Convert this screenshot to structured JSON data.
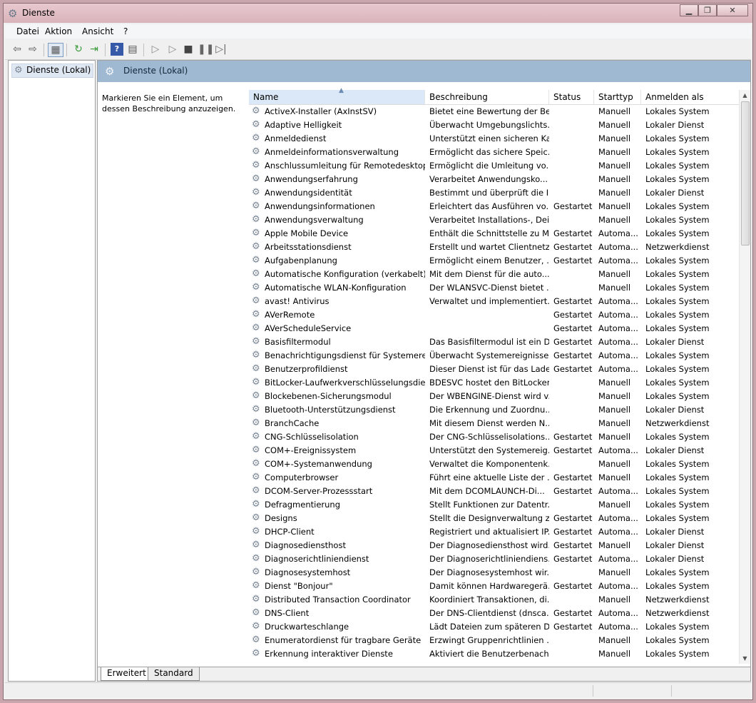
{
  "window": {
    "title": "Dienste",
    "app_icon": "gear-icon"
  },
  "menu": [
    "Datei",
    "Aktion",
    "Ansicht",
    "?"
  ],
  "toolbar_icons": [
    "back-arrow-icon",
    "forward-arrow-icon",
    "show-hide-console-tree-icon",
    "refresh-icon",
    "export-list-icon",
    "help-icon",
    "properties-icon",
    "start-service-icon",
    "start-service-alt-icon",
    "stop-service-icon",
    "pause-service-icon",
    "restart-service-icon"
  ],
  "tree": {
    "item": "Dienste (Lokal)"
  },
  "header": {
    "title": "Dienste (Lokal)"
  },
  "description_panel": {
    "text": "Markieren Sie ein Element, um dessen Beschreibung anzuzeigen."
  },
  "columns": [
    "Name",
    "Beschreibung",
    "Status",
    "Starttyp",
    "Anmelden als"
  ],
  "rows": [
    [
      "ActiveX-Installer (AxInstSV)",
      "Bietet eine Bewertung der Be...",
      "",
      "Manuell",
      "Lokales System"
    ],
    [
      "Adaptive Helligkeit",
      "Überwacht Umgebungslichts...",
      "",
      "Manuell",
      "Lokaler Dienst"
    ],
    [
      "Anmeldedienst",
      "Unterstützt einen sicheren Ka...",
      "",
      "Manuell",
      "Lokales System"
    ],
    [
      "Anmeldeinformationsverwaltung",
      "Ermöglicht das sichere Speic...",
      "",
      "Manuell",
      "Lokales System"
    ],
    [
      "Anschlussumleitung für Remotedesktop...",
      "Ermöglicht die Umleitung vo...",
      "",
      "Manuell",
      "Lokales System"
    ],
    [
      "Anwendungserfahrung",
      "Verarbeitet Anwendungsko...",
      "",
      "Manuell",
      "Lokales System"
    ],
    [
      "Anwendungsidentität",
      "Bestimmt und überprüft die I...",
      "",
      "Manuell",
      "Lokaler Dienst"
    ],
    [
      "Anwendungsinformationen",
      "Erleichtert das Ausführen vo...",
      "Gestartet",
      "Manuell",
      "Lokales System"
    ],
    [
      "Anwendungsverwaltung",
      "Verarbeitet Installations-, Dei...",
      "",
      "Manuell",
      "Lokales System"
    ],
    [
      "Apple Mobile Device",
      "Enthält die Schnittstelle zu M...",
      "Gestartet",
      "Automa...",
      "Lokales System"
    ],
    [
      "Arbeitsstationsdienst",
      "Erstellt und wartet Clientnetz...",
      "Gestartet",
      "Automa...",
      "Netzwerkdienst"
    ],
    [
      "Aufgabenplanung",
      "Ermöglicht einem Benutzer, ...",
      "Gestartet",
      "Automa...",
      "Lokales System"
    ],
    [
      "Automatische Konfiguration (verkabelt)",
      "Mit dem Dienst für die auto...",
      "",
      "Manuell",
      "Lokales System"
    ],
    [
      "Automatische WLAN-Konfiguration",
      "Der WLANSVC-Dienst bietet ...",
      "",
      "Manuell",
      "Lokales System"
    ],
    [
      "avast! Antivirus",
      "Verwaltet und implementiert...",
      "Gestartet",
      "Automa...",
      "Lokales System"
    ],
    [
      "AVerRemote",
      "",
      "Gestartet",
      "Automa...",
      "Lokales System"
    ],
    [
      "AVerScheduleService",
      "",
      "Gestartet",
      "Automa...",
      "Lokales System"
    ],
    [
      "Basisfiltermodul",
      "Das Basisfiltermodul ist ein D...",
      "Gestartet",
      "Automa...",
      "Lokaler Dienst"
    ],
    [
      "Benachrichtigungsdienst für Systemerei...",
      "Überwacht Systemereignisse ...",
      "Gestartet",
      "Automa...",
      "Lokales System"
    ],
    [
      "Benutzerprofildienst",
      "Dieser Dienst ist für das Lade...",
      "Gestartet",
      "Automa...",
      "Lokales System"
    ],
    [
      "BitLocker-Laufwerkverschlüsselungsdienst",
      "BDESVC hostet den BitLocker...",
      "",
      "Manuell",
      "Lokales System"
    ],
    [
      "Blockebenen-Sicherungsmodul",
      "Der WBENGINE-Dienst wird v...",
      "",
      "Manuell",
      "Lokales System"
    ],
    [
      "Bluetooth-Unterstützungsdienst",
      "Die Erkennung und Zuordnu...",
      "",
      "Manuell",
      "Lokaler Dienst"
    ],
    [
      "BranchCache",
      "Mit diesem Dienst werden N...",
      "",
      "Manuell",
      "Netzwerkdienst"
    ],
    [
      "CNG-Schlüsselisolation",
      "Der CNG-Schlüsselisolations...",
      "Gestartet",
      "Manuell",
      "Lokales System"
    ],
    [
      "COM+-Ereignissystem",
      "Unterstützt den Systemereig...",
      "Gestartet",
      "Automa...",
      "Lokaler Dienst"
    ],
    [
      "COM+-Systemanwendung",
      "Verwaltet die Komponentenk...",
      "",
      "Manuell",
      "Lokales System"
    ],
    [
      "Computerbrowser",
      "Führt eine aktuelle Liste der ...",
      "Gestartet",
      "Manuell",
      "Lokales System"
    ],
    [
      "DCOM-Server-Prozessstart",
      "Mit dem DCOMLAUNCH-Di...",
      "Gestartet",
      "Automa...",
      "Lokales System"
    ],
    [
      "Defragmentierung",
      "Stellt Funktionen zur Datentr...",
      "",
      "Manuell",
      "Lokales System"
    ],
    [
      "Designs",
      "Stellt die Designverwaltung z...",
      "Gestartet",
      "Automa...",
      "Lokales System"
    ],
    [
      "DHCP-Client",
      "Registriert und aktualisiert IP...",
      "Gestartet",
      "Automa...",
      "Lokaler Dienst"
    ],
    [
      "Diagnosediensthost",
      "Der Diagnosediensthost wird...",
      "Gestartet",
      "Manuell",
      "Lokaler Dienst"
    ],
    [
      "Diagnoserichtliniendienst",
      "Der Diagnoserichtliniendiens...",
      "Gestartet",
      "Automa...",
      "Lokaler Dienst"
    ],
    [
      "Diagnosesystemhost",
      "Der Diagnosesystemhost wir...",
      "",
      "Manuell",
      "Lokales System"
    ],
    [
      "Dienst \"Bonjour\"",
      "Damit können Hardwaregerä...",
      "Gestartet",
      "Automa...",
      "Lokales System"
    ],
    [
      "Distributed Transaction Coordinator",
      "Koordiniert Transaktionen, di...",
      "",
      "Manuell",
      "Netzwerkdienst"
    ],
    [
      "DNS-Client",
      "Der DNS-Clientdienst (dnsca...",
      "Gestartet",
      "Automa...",
      "Netzwerkdienst"
    ],
    [
      "Druckwarteschlange",
      "Lädt Dateien zum späteren D...",
      "Gestartet",
      "Automa...",
      "Lokales System"
    ],
    [
      "Enumeratordienst für tragbare Geräte",
      "Erzwingt Gruppenrichtlinien ...",
      "",
      "Manuell",
      "Lokales System"
    ],
    [
      "Erkennung interaktiver Dienste",
      "Aktiviert die Benutzerbenach...",
      "",
      "Manuell",
      "Lokales System"
    ]
  ],
  "tabs": [
    "Erweitert",
    "Standard"
  ]
}
